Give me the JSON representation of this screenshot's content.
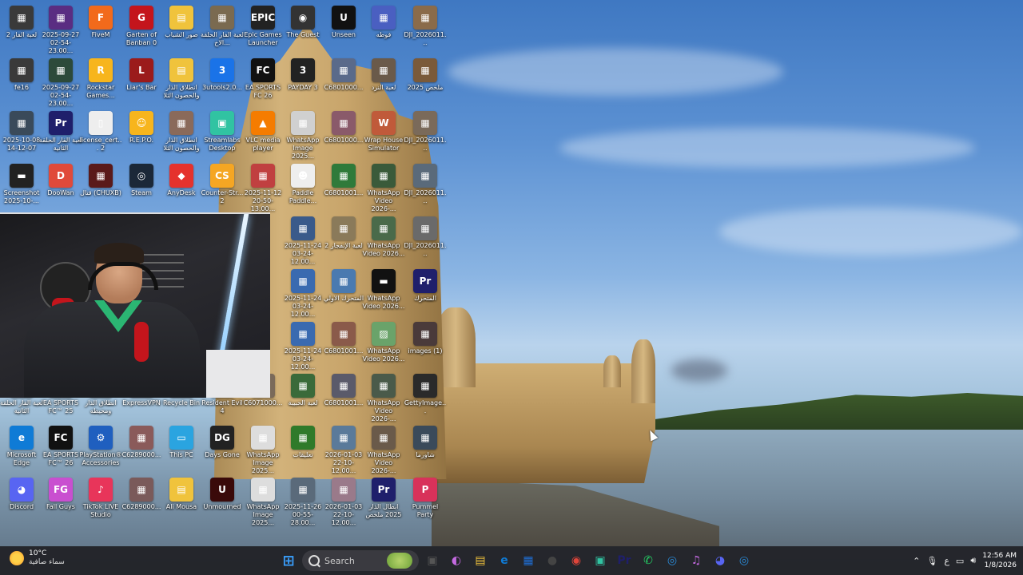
{
  "desktop": {
    "icons": [
      {
        "label": "لعبة الفار 2",
        "color": "#3a3a3a",
        "glyph": "▦",
        "col": 0,
        "row": 0
      },
      {
        "label": "2025-09-27 02-54-23.00...",
        "color": "#5a2d82",
        "glyph": "▦",
        "col": 1,
        "row": 0
      },
      {
        "label": "FiveM",
        "color": "#f26a1b",
        "glyph": "F",
        "col": 2,
        "row": 0
      },
      {
        "label": "Garten of Banban 0",
        "color": "#c4151c",
        "glyph": "G",
        "col": 3,
        "row": 0
      },
      {
        "label": "صور الشباب",
        "color": "#f0c33c",
        "glyph": "▤",
        "col": 4,
        "row": 0
      },
      {
        "label": "لعبة الفار الحلقة الاخ...",
        "color": "#7a6a50",
        "glyph": "▦",
        "col": 5,
        "row": 0
      },
      {
        "label": "Epic Games Launcher",
        "color": "#222222",
        "glyph": "EPIC",
        "col": 6,
        "row": 0
      },
      {
        "label": "The Guest",
        "color": "#333333",
        "glyph": "◉",
        "col": 7,
        "row": 0
      },
      {
        "label": "Unseen",
        "color": "#111111",
        "glyph": "U",
        "col": 8,
        "row": 0
      },
      {
        "label": "فوطه",
        "color": "#4a5fc1",
        "glyph": "▦",
        "col": 9,
        "row": 0
      },
      {
        "label": "DJI_2026011...",
        "color": "#8a6b4a",
        "glyph": "▦",
        "col": 10,
        "row": 0
      },
      {
        "label": "fe16",
        "color": "#3a3a3a",
        "glyph": "▦",
        "col": 0,
        "row": 1
      },
      {
        "label": "2025-09-27 02-54-23.00...",
        "color": "#2d4a3a",
        "glyph": "▦",
        "col": 1,
        "row": 1
      },
      {
        "label": "Rockstar Games...",
        "color": "#f7b51d",
        "glyph": "R",
        "col": 2,
        "row": 1
      },
      {
        "label": "Liar's Bar",
        "color": "#9b1b1b",
        "glyph": "L",
        "col": 3,
        "row": 1
      },
      {
        "label": "انطلاق الذار والحصون الثلا",
        "color": "#f0c33c",
        "glyph": "▤",
        "col": 4,
        "row": 1
      },
      {
        "label": "3utools2.0...",
        "color": "#1a73e8",
        "glyph": "3",
        "col": 5,
        "row": 1
      },
      {
        "label": "EA SPORTS FC 26",
        "color": "#111111",
        "glyph": "FC",
        "col": 6,
        "row": 1
      },
      {
        "label": "PAYDAY 3",
        "color": "#222222",
        "glyph": "3",
        "col": 7,
        "row": 1
      },
      {
        "label": "C6801000...",
        "color": "#5a6a8a",
        "glyph": "▦",
        "col": 8,
        "row": 1
      },
      {
        "label": "لعبة النرد",
        "color": "#6a5a4a",
        "glyph": "▦",
        "col": 9,
        "row": 1
      },
      {
        "label": "ملخص 2025",
        "color": "#7a5a3a",
        "glyph": "▦",
        "col": 10,
        "row": 1
      },
      {
        "label": "2025-10-08 14-12-07",
        "color": "#3a4a5a",
        "glyph": "▦",
        "col": 0,
        "row": 2
      },
      {
        "label": "لعبة الفار الحلقة الثانية",
        "color": "#1f1f6b",
        "glyph": "Pr",
        "col": 1,
        "row": 2
      },
      {
        "label": "license_cert... 2",
        "color": "#eeeeee",
        "glyph": "▯",
        "col": 2,
        "row": 2
      },
      {
        "label": "R.E.P.O.",
        "color": "#f7b51d",
        "glyph": "☺",
        "col": 3,
        "row": 2
      },
      {
        "label": "انطلاق الذار والحصون الثلا",
        "color": "#8a6a5a",
        "glyph": "▦",
        "col": 4,
        "row": 2
      },
      {
        "label": "Streamlabs Desktop",
        "color": "#31c3a2",
        "glyph": "▣",
        "col": 5,
        "row": 2
      },
      {
        "label": "VLC media player",
        "color": "#f57c00",
        "glyph": "▲",
        "col": 6,
        "row": 2
      },
      {
        "label": "WhatsApp Image 2025...",
        "color": "#d0d0d0",
        "glyph": "▦",
        "col": 7,
        "row": 2
      },
      {
        "label": "C6801000...",
        "color": "#8a5a6a",
        "glyph": "▦",
        "col": 8,
        "row": 2
      },
      {
        "label": "Wrap House Simulator",
        "color": "#c05a3a",
        "glyph": "W",
        "col": 9,
        "row": 2
      },
      {
        "label": "DJI_2026011...",
        "color": "#7a6a5a",
        "glyph": "▦",
        "col": 10,
        "row": 2
      },
      {
        "label": "Screenshot 2025-10-...",
        "color": "#222222",
        "glyph": "▬",
        "col": 0,
        "row": 3
      },
      {
        "label": "DooWan",
        "color": "#e04a3a",
        "glyph": "D",
        "col": 1,
        "row": 3
      },
      {
        "label": "قتال (CHUXB)",
        "color": "#5a1a1a",
        "glyph": "▦",
        "col": 2,
        "row": 3
      },
      {
        "label": "Steam",
        "color": "#1b2838",
        "glyph": "◎",
        "col": 3,
        "row": 3
      },
      {
        "label": "AnyDesk",
        "color": "#e5322d",
        "glyph": "◆",
        "col": 4,
        "row": 3
      },
      {
        "label": "Counter-Str... 2",
        "color": "#f5a623",
        "glyph": "CS",
        "col": 5,
        "row": 3
      },
      {
        "label": "2025-11-12 20-50-13.00...",
        "color": "#c04040",
        "glyph": "▦",
        "col": 6,
        "row": 3
      },
      {
        "label": "Paddle Paddle...",
        "color": "#eeeeee",
        "glyph": "☻",
        "col": 7,
        "row": 3
      },
      {
        "label": "C6801001...",
        "color": "#2f7a3a",
        "glyph": "▦",
        "col": 8,
        "row": 3
      },
      {
        "label": "WhatsApp Video 2026-...",
        "color": "#3a5a3a",
        "glyph": "▦",
        "col": 9,
        "row": 3
      },
      {
        "label": "DJI_2026011...",
        "color": "#5a6a7a",
        "glyph": "▦",
        "col": 10,
        "row": 3
      },
      {
        "label": "2025-11-24 03-24-12.00...",
        "color": "#3a5a8a",
        "glyph": "▦",
        "col": 7,
        "row": 4
      },
      {
        "label": "لعبة الإنفجار 2",
        "color": "#8a7a5a",
        "glyph": "▦",
        "col": 8,
        "row": 4
      },
      {
        "label": "WhatsApp Video 2026...",
        "color": "#4a6a4a",
        "glyph": "▦",
        "col": 9,
        "row": 4
      },
      {
        "label": "DJI_2026011...",
        "color": "#6a6a6a",
        "glyph": "▦",
        "col": 10,
        "row": 4
      },
      {
        "label": "2025-11-24 03-24-12.00...",
        "color": "#3a6ab0",
        "glyph": "▦",
        "col": 7,
        "row": 5
      },
      {
        "label": "المتحرك الاولي",
        "color": "#4a7ab0",
        "glyph": "▦",
        "col": 8,
        "row": 5
      },
      {
        "label": "WhatsApp Video 2026...",
        "color": "#111111",
        "glyph": "▬",
        "col": 9,
        "row": 5
      },
      {
        "label": "المتحرك",
        "color": "#1f1f6b",
        "glyph": "Pr",
        "col": 10,
        "row": 5
      },
      {
        "label": "2025-11-24 03-24-12.00...",
        "color": "#3a6ab0",
        "glyph": "▦",
        "col": 7,
        "row": 6
      },
      {
        "label": "C6801001...",
        "color": "#8a5a4a",
        "glyph": "▦",
        "col": 8,
        "row": 6
      },
      {
        "label": "WhatsApp Video 2026...",
        "color": "#6aa36a",
        "glyph": "▨",
        "col": 9,
        "row": 6
      },
      {
        "label": "images (1)",
        "color": "#4a3a3a",
        "glyph": "▦",
        "col": 10,
        "row": 6
      },
      {
        "label": "لعبة الفار الحلقة الثانية",
        "color": "#6a5a4a",
        "glyph": "▦",
        "col": 0,
        "row": 7
      },
      {
        "label": "EA SPORTS FC™ 25",
        "color": "#333333",
        "glyph": "FC",
        "col": 1,
        "row": 7
      },
      {
        "label": "انطلاق الذار ومحيطه",
        "color": "#4a4a4a",
        "glyph": "▦",
        "col": 2,
        "row": 7
      },
      {
        "label": "ExpressVPN",
        "color": "#da3940",
        "glyph": "E",
        "col": 3,
        "row": 7
      },
      {
        "label": "Recycle Bin",
        "color": "#cfe3f5",
        "glyph": "♻",
        "col": 4,
        "row": 7
      },
      {
        "label": "Resident Evil 4",
        "color": "#5a1a1a",
        "glyph": "RE",
        "col": 5,
        "row": 7
      },
      {
        "label": "C6071000...",
        "color": "#7a6a5a",
        "glyph": "▦",
        "col": 6,
        "row": 7
      },
      {
        "label": "لعبة الحبيبة",
        "color": "#3a6a3a",
        "glyph": "▦",
        "col": 7,
        "row": 7
      },
      {
        "label": "C6801001...",
        "color": "#5a5a6a",
        "glyph": "▦",
        "col": 8,
        "row": 7
      },
      {
        "label": "WhatsApp Video 2026-...",
        "color": "#4a5a4a",
        "glyph": "▦",
        "col": 9,
        "row": 7
      },
      {
        "label": "GettyImage...",
        "color": "#2a2a2a",
        "glyph": "▦",
        "col": 10,
        "row": 7
      },
      {
        "label": "Microsoft Edge",
        "color": "#0f7bd6",
        "glyph": "e",
        "col": 0,
        "row": 8
      },
      {
        "label": "EA SPORTS FC™ 26",
        "color": "#111111",
        "glyph": "FC",
        "col": 1,
        "row": 8
      },
      {
        "label": "PlayStation® Accessories",
        "color": "#1f5fbf",
        "glyph": "⚙",
        "col": 2,
        "row": 8
      },
      {
        "label": "C6289000...",
        "color": "#8a5a5a",
        "glyph": "▦",
        "col": 3,
        "row": 8
      },
      {
        "label": "This PC",
        "color": "#2aa4e0",
        "glyph": "▭",
        "col": 4,
        "row": 8
      },
      {
        "label": "Days Gone",
        "color": "#222222",
        "glyph": "DG",
        "col": 5,
        "row": 8
      },
      {
        "label": "WhatsApp Image 2025...",
        "color": "#dddddd",
        "glyph": "▦",
        "col": 6,
        "row": 8
      },
      {
        "label": "تعليقات",
        "color": "#2f7a2a",
        "glyph": "▦",
        "col": 7,
        "row": 8
      },
      {
        "label": "2026-01-03 22-10-12.00...",
        "color": "#5a7a9a",
        "glyph": "▦",
        "col": 8,
        "row": 8
      },
      {
        "label": "WhatsApp Video 2026-...",
        "color": "#6a5a4a",
        "glyph": "▦",
        "col": 9,
        "row": 8
      },
      {
        "label": "شاورما",
        "color": "#3a4a5a",
        "glyph": "▦",
        "col": 10,
        "row": 8
      },
      {
        "label": "Discord",
        "color": "#5865f2",
        "glyph": "◕",
        "col": 0,
        "row": 9
      },
      {
        "label": "Fall Guys",
        "color": "#c94fd0",
        "glyph": "FG",
        "col": 1,
        "row": 9
      },
      {
        "label": "TikTok LIVE Studio",
        "color": "#e8355a",
        "glyph": "♪",
        "col": 2,
        "row": 9
      },
      {
        "label": "C6289000...",
        "color": "#7a5a5a",
        "glyph": "▦",
        "col": 3,
        "row": 9
      },
      {
        "label": "Ali Mousa",
        "color": "#f0c33c",
        "glyph": "▤",
        "col": 4,
        "row": 9
      },
      {
        "label": "Unmourned",
        "color": "#3a0a0a",
        "glyph": "U",
        "col": 5,
        "row": 9
      },
      {
        "label": "WhatsApp Image 2025...",
        "color": "#dddddd",
        "glyph": "▦",
        "col": 6,
        "row": 9
      },
      {
        "label": "2025-11-26 00-55-28.00...",
        "color": "#5a6a7a",
        "glyph": "▦",
        "col": 7,
        "row": 9
      },
      {
        "label": "2026-01-03 22-10-12.00...",
        "color": "#9a7a8a",
        "glyph": "▦",
        "col": 8,
        "row": 9
      },
      {
        "label": "ابطال الذار 2025 ملخص",
        "color": "#1f1f6b",
        "glyph": "Pr",
        "col": 9,
        "row": 9
      },
      {
        "label": "Pummel Party",
        "color": "#d8325a",
        "glyph": "P",
        "col": 10,
        "row": 9
      }
    ]
  },
  "taskbar": {
    "weather": {
      "temp": "10°C",
      "desc": "سماء صافية"
    },
    "search_placeholder": "Search",
    "apps": [
      {
        "name": "windows-start",
        "glyph": "⊞",
        "color": "#3aa0ff"
      },
      {
        "name": "search"
      },
      {
        "name": "task-view",
        "glyph": "▣",
        "color": "#555555"
      },
      {
        "name": "copilot",
        "glyph": "◐",
        "color": "#c46ae0"
      },
      {
        "name": "file-explorer",
        "glyph": "▤",
        "color": "#f0c33c"
      },
      {
        "name": "edge",
        "glyph": "e",
        "color": "#0f7bd6"
      },
      {
        "name": "store",
        "glyph": "▦",
        "color": "#1f6fd6"
      },
      {
        "name": "pin-app",
        "glyph": "●",
        "color": "#444444"
      },
      {
        "name": "chrome",
        "glyph": "◉",
        "color": "#e0453a"
      },
      {
        "name": "streamlabs",
        "glyph": "▣",
        "color": "#31c3a2"
      },
      {
        "name": "premiere",
        "glyph": "Pr",
        "color": "#1f1f6b"
      },
      {
        "name": "whatsapp",
        "glyph": "✆",
        "color": "#25d366"
      },
      {
        "name": "app-blue",
        "glyph": "◎",
        "color": "#2a8ad6"
      },
      {
        "name": "music",
        "glyph": "♫",
        "color": "#c46ae0"
      },
      {
        "name": "discord",
        "glyph": "◕",
        "color": "#5865f2"
      },
      {
        "name": "app-circle",
        "glyph": "◎",
        "color": "#2a8ad6"
      }
    ],
    "tray": {
      "lang": "ع",
      "time": "12:56 AM",
      "date": "1/8/2026"
    }
  }
}
